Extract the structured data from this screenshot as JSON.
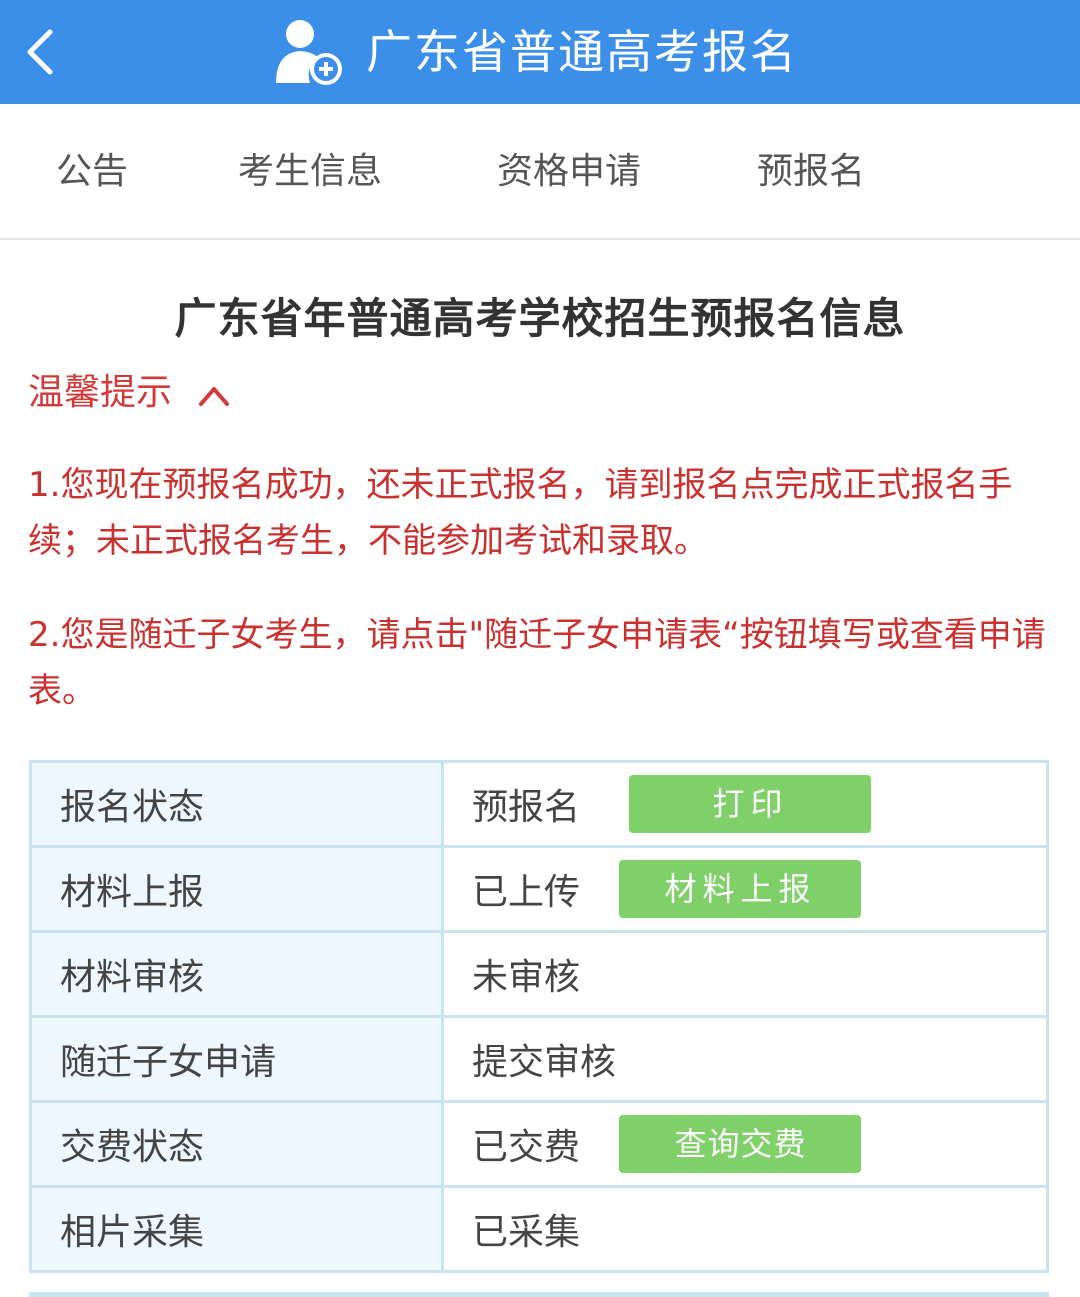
{
  "header": {
    "title": "广东省普通高考报名",
    "back_icon": "chevron-left-icon",
    "app_icon": "user-add-icon",
    "color": "#3b8fe8"
  },
  "tabs": [
    {
      "label": "公告"
    },
    {
      "label": "考生信息"
    },
    {
      "label": "资格申请"
    },
    {
      "label": "预报名"
    }
  ],
  "main": {
    "title": "广东省年普通高考学校招生预报名信息",
    "tip_label": "温馨提示",
    "tip_icon": "chevron-up-icon",
    "tips": [
      "1.您现在预报名成功，还未正式报名，请到报名点完成正式报名手续；未正式报名考生，不能参加考试和录取。",
      "2.您是随迁子女考生，请点击\"随迁子女申请表“按钮填写或查看申请表。"
    ],
    "tip_color": "#c9312f"
  },
  "table": {
    "rows": [
      {
        "label": "报名状态",
        "value": "预报名",
        "button": "打印"
      },
      {
        "label": "材料上报",
        "value": "已上传",
        "button": "材料上报"
      },
      {
        "label": "材料审核",
        "value": "未审核"
      },
      {
        "label": "随迁子女申请",
        "value": "提交审核"
      },
      {
        "label": "交费状态",
        "value": "已交费",
        "button": "查询交费"
      },
      {
        "label": "相片采集",
        "value": "已采集"
      }
    ],
    "button_color": "#7fd069",
    "label_bg": "#eef7fd",
    "border_color": "#c9e3f1"
  }
}
